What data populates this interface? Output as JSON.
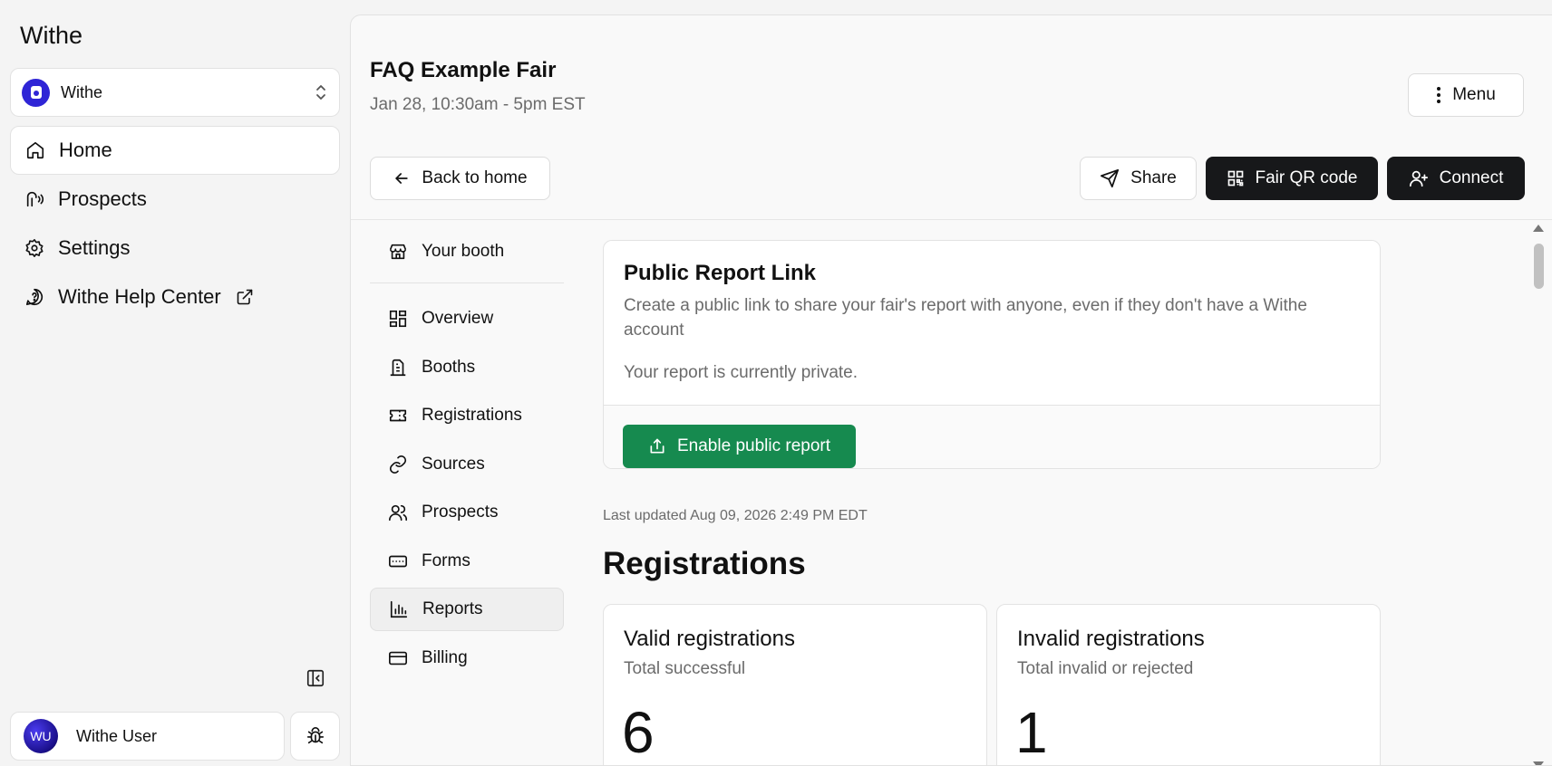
{
  "sidebar": {
    "app_title": "Withe",
    "org": {
      "name": "Withe"
    },
    "nav": [
      {
        "label": "Home",
        "icon": "home-icon",
        "active": true
      },
      {
        "label": "Prospects",
        "icon": "prospects-icon"
      },
      {
        "label": "Settings",
        "icon": "gear-icon"
      },
      {
        "label": "Withe Help Center",
        "icon": "help-icon",
        "external": true
      }
    ],
    "user": {
      "initials": "WU",
      "name": "Withe User"
    }
  },
  "header": {
    "title": "FAQ Example Fair",
    "date": "Jan 28, 10:30am - 5pm EST",
    "menu_label": "Menu",
    "back_label": "Back to home",
    "share_label": "Share",
    "qr_label": "Fair QR code",
    "connect_label": "Connect"
  },
  "subnav": {
    "booth_label": "Your booth",
    "items": [
      {
        "label": "Overview",
        "icon": "grid-icon"
      },
      {
        "label": "Booths",
        "icon": "building-icon"
      },
      {
        "label": "Registrations",
        "icon": "ticket-icon"
      },
      {
        "label": "Sources",
        "icon": "link-icon"
      },
      {
        "label": "Prospects",
        "icon": "users-icon"
      },
      {
        "label": "Forms",
        "icon": "form-icon"
      },
      {
        "label": "Reports",
        "icon": "bar-chart-icon",
        "active": true
      },
      {
        "label": "Billing",
        "icon": "credit-card-icon"
      }
    ]
  },
  "report_link": {
    "title": "Public Report Link",
    "description": "Create a public link to share your fair's report with anyone, even if they don't have a Withe account",
    "status": "Your report is currently private.",
    "button_label": "Enable public report"
  },
  "last_updated": "Last updated Aug 09, 2026 2:49 PM EDT",
  "registrations": {
    "section_title": "Registrations",
    "valid": {
      "title": "Valid registrations",
      "subtitle": "Total successful",
      "value": "6"
    },
    "invalid": {
      "title": "Invalid registrations",
      "subtitle": "Total invalid or rejected",
      "value": "1"
    }
  },
  "colors": {
    "accent_green": "#168a4f",
    "dark_button": "#17181a",
    "org_logo": "#2f25d6"
  }
}
